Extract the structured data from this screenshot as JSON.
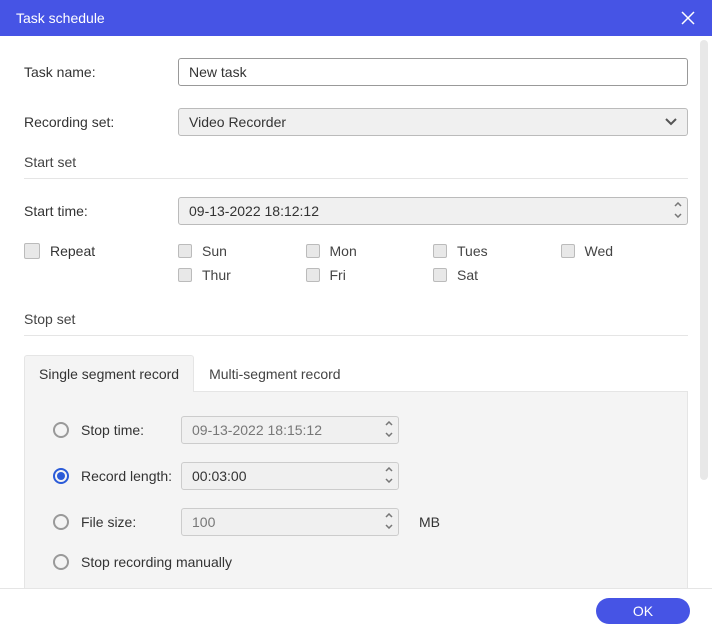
{
  "window": {
    "title": "Task schedule"
  },
  "labels": {
    "task_name": "Task name:",
    "recording_set": "Recording set:",
    "start_set": "Start set",
    "start_time": "Start time:",
    "repeat": "Repeat",
    "stop_set": "Stop set"
  },
  "task_name_value": "New task",
  "recording_set_value": "Video Recorder",
  "start_time_value": "09-13-2022 18:12:12",
  "days": {
    "sun": "Sun",
    "mon": "Mon",
    "tues": "Tues",
    "wed": "Wed",
    "thur": "Thur",
    "fri": "Fri",
    "sat": "Sat"
  },
  "tabs": {
    "single": "Single segment record",
    "multi": "Multi-segment record"
  },
  "stop_opts": {
    "stop_time_label": "Stop time:",
    "stop_time_value": "09-13-2022 18:15:12",
    "record_length_label": "Record length:",
    "record_length_value": "00:03:00",
    "file_size_label": "File size:",
    "file_size_value": "100",
    "file_size_unit": "MB",
    "manual_label": "Stop recording manually"
  },
  "buttons": {
    "ok": "OK"
  }
}
